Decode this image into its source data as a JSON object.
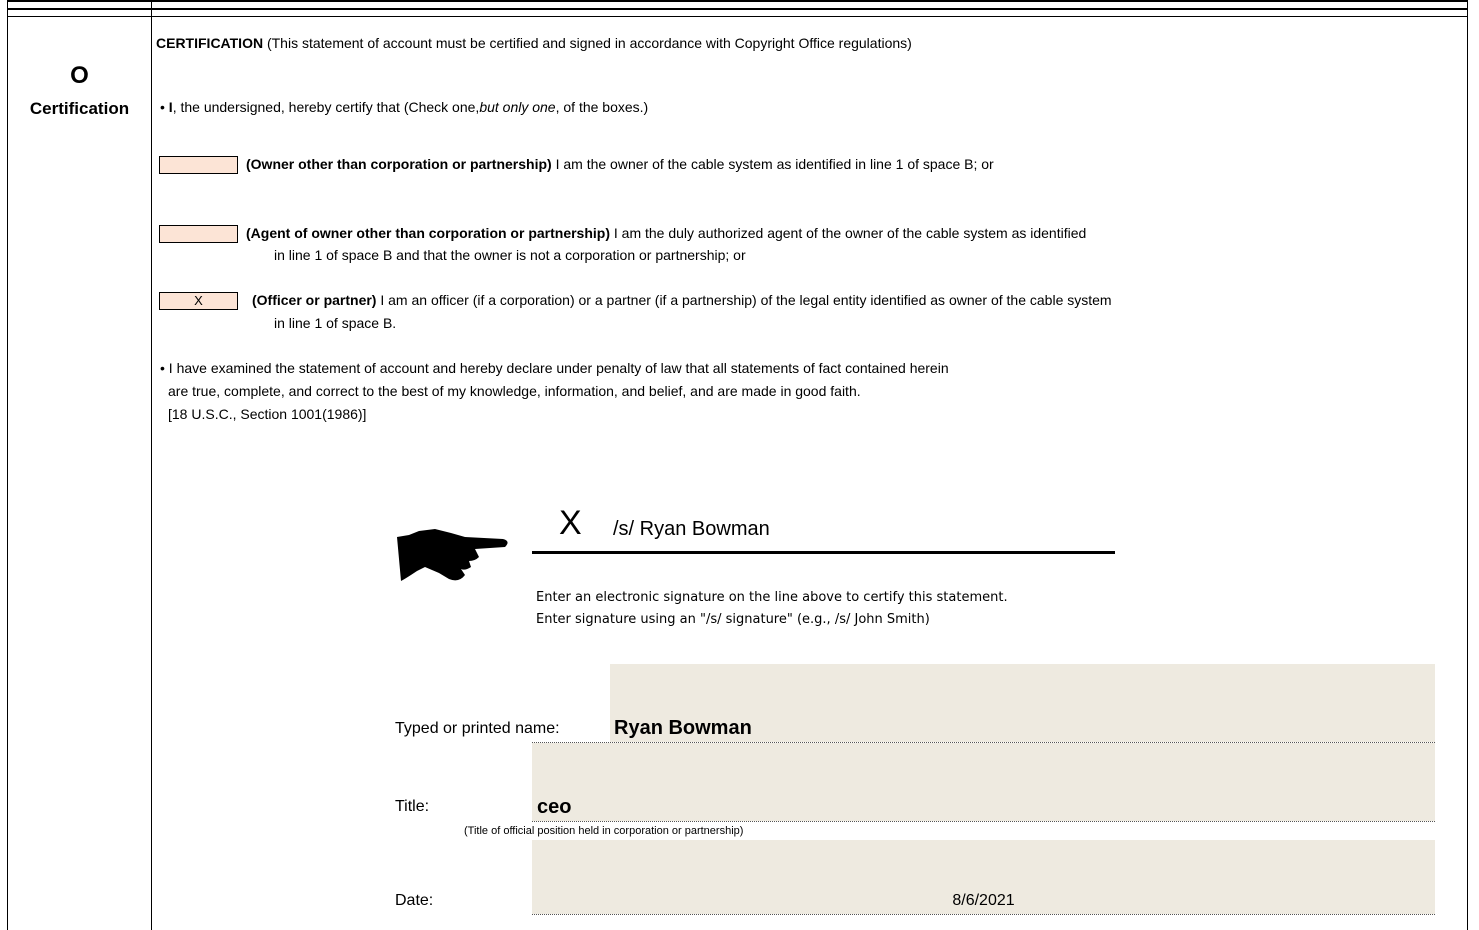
{
  "space": {
    "letter": "O",
    "label": "Certification"
  },
  "certification": {
    "heading": "CERTIFICATION",
    "heading_note": " (This statement of account must be certified and signed in accordance with Copyright Office regulations)",
    "intro_bullet": "• ",
    "intro_i": "I",
    "intro_text": ", the undersigned, hereby certify that (Check one,",
    "intro_italic": "but only one",
    "intro_end": ", of the boxes.)"
  },
  "options": [
    {
      "checked_mark": "",
      "bold": "(Owner other than corporation or partnership)",
      "text": " I am the owner of the cable system as identified in line 1 of space B; or",
      "line2": ""
    },
    {
      "checked_mark": "",
      "bold": "(Agent of owner other than corporation or partnership)",
      "text": " I am the duly authorized agent of the owner of the cable system as identified",
      "line2": "in line 1 of space B and that the owner is not a corporation or partnership; or"
    },
    {
      "checked_mark": "X",
      "bold": "(Officer or partner)",
      "text": " I am an officer (if a corporation) or a partner (if a partnership) of the legal entity identified as owner of the cable system",
      "line2": "in line 1 of space B."
    }
  ],
  "declaration": {
    "line1": "• I have examined the statement of account and hereby declare under penalty of law that all statements of fact contained herein",
    "line2": "are true, complete, and correct to the best of my knowledge, information, and belief, and are made in good faith.",
    "line3": "[18 U.S.C., Section 1001(1986)]"
  },
  "signature": {
    "x_mark": "X",
    "value": "/s/ Ryan Bowman",
    "instruction1": "Enter an electronic signature on the line above to certify this statement.",
    "instruction2": "Enter signature using an \"/s/ signature\" (e.g.,  /s/ John Smith)"
  },
  "fields": {
    "name_label": "Typed or printed name:",
    "name_value": "Ryan Bowman",
    "title_label": "Title:",
    "title_value": "ceo",
    "title_note": "(Title of official position held in corporation or partnership)",
    "date_label": "Date:",
    "date_value": "8/6/2021"
  },
  "colors": {
    "checkbox_fill": "#fce4d6",
    "field_fill": "#eeeae0"
  },
  "icons": {
    "pointer": "pointing-hand-icon"
  }
}
